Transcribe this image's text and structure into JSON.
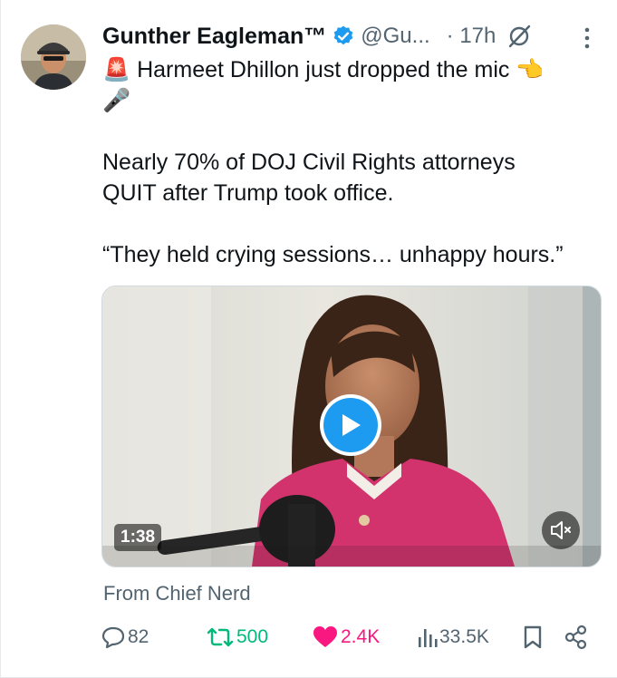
{
  "author": {
    "name": "Gunther Eagleman™",
    "handle": "@Gu...",
    "time": "· 17h"
  },
  "tweet": {
    "line1": "Harmeet Dhillon just dropped the mic",
    "emoji_siren": "🚨",
    "emoji_point": "👈",
    "emoji_mic": "🎤",
    "line2": "Nearly 70% of DOJ Civil Rights attorneys",
    "line3": "QUIT after Trump took office.",
    "line4": "“They held crying sessions… unhappy hours.”"
  },
  "media": {
    "duration": "1:38",
    "play_icon": "play-icon",
    "mute_icon": "mute-icon"
  },
  "source": "From Chief Nerd",
  "actions": {
    "replies": "82",
    "reposts": "500",
    "likes": "2.4K",
    "views": "33.5K"
  },
  "colors": {
    "accent": "#1d9bf0",
    "repost": "#00ba7c",
    "like": "#f91880",
    "muted_text": "#536471"
  }
}
